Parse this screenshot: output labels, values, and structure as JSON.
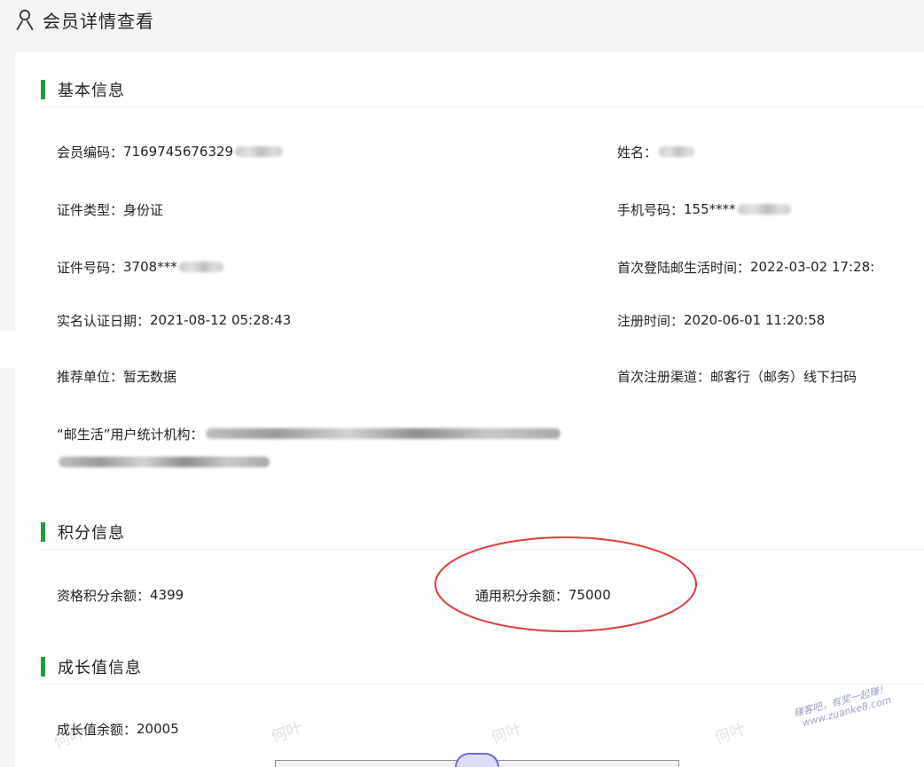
{
  "header": {
    "title": "会员详情查看",
    "icon": "user-icon"
  },
  "basic": {
    "title": "基本信息",
    "member_id": {
      "label": "会员编码：",
      "value": "7169745676329"
    },
    "name": {
      "label": "姓名：",
      "value": ""
    },
    "id_type": {
      "label": "证件类型：",
      "value": "身份证"
    },
    "phone": {
      "label": "手机号码：",
      "value": "155****"
    },
    "id_number": {
      "label": "证件号码：",
      "value": "3708***"
    },
    "first_login": {
      "label": "首次登陆邮生活时间：",
      "value": "2022-03-02 17:28:"
    },
    "realname_date": {
      "label": "实名认证日期：",
      "value": "2021-08-12 05:28:43"
    },
    "register_time": {
      "label": "注册时间：",
      "value": "2020-06-01 11:20:58"
    },
    "referrer": {
      "label": "推荐单位：",
      "value": "暂无数据"
    },
    "first_channel": {
      "label": "首次注册渠道：",
      "value": "邮客行（邮务）线下扫码"
    },
    "stat_org": {
      "label": "“邮生活”用户统计机构：",
      "value": ""
    }
  },
  "points": {
    "title": "积分信息",
    "qualification": {
      "label": "资格积分余额：",
      "value": "4399"
    },
    "general": {
      "label": "通用积分余额：",
      "value": "75000"
    }
  },
  "growth": {
    "title": "成长值信息",
    "balance": {
      "label": "成长值余额：",
      "value": "20005"
    }
  },
  "watermarks": {
    "hy": "何叶",
    "site_line1": "赚客吧，有奖一起赚！",
    "site_line2": "www.zuanke8.com"
  },
  "colors": {
    "accent": "#1f9d3a",
    "highlight": "#e23b3b"
  }
}
